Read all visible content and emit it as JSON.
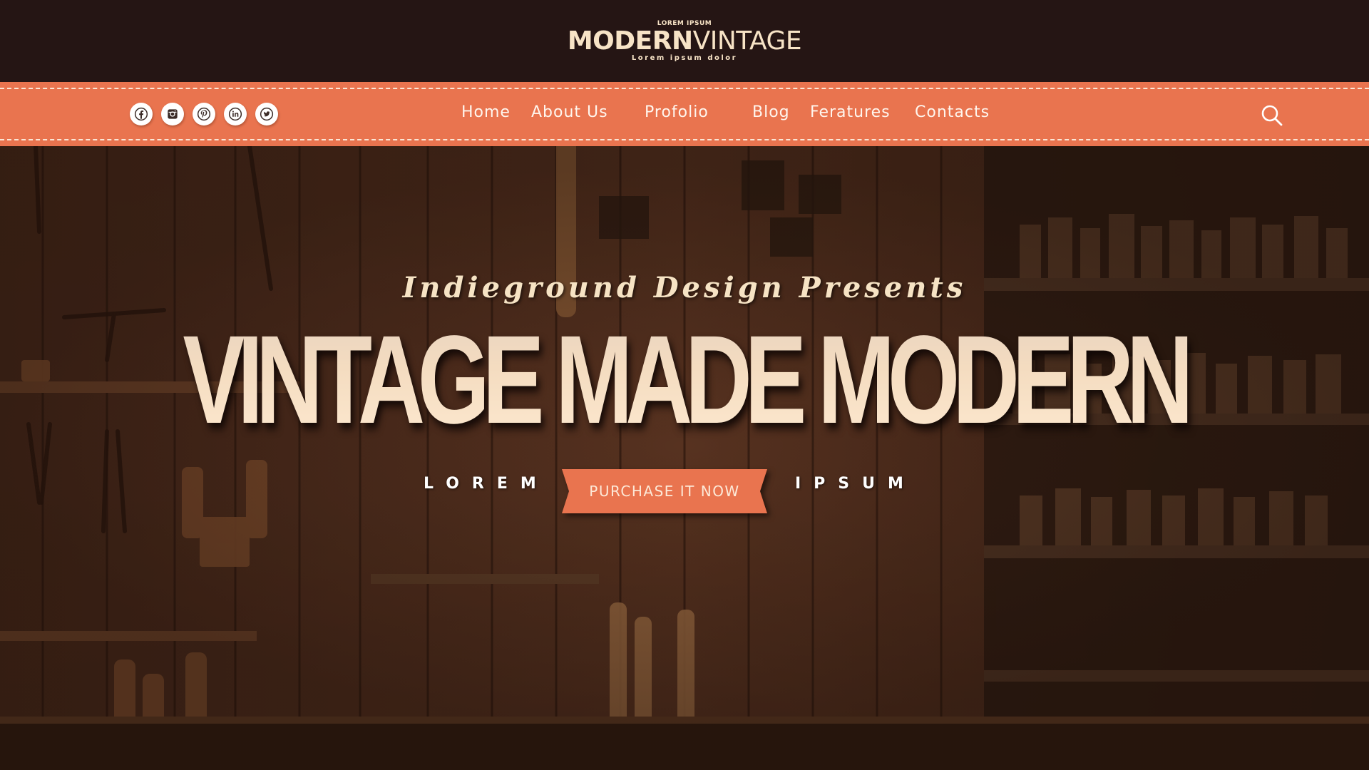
{
  "brand": {
    "kicker": "LOREM IPSUM",
    "name_bold": "MODERN",
    "name_light": "VINTAGE",
    "tagline": "Lorem ipsum dolor"
  },
  "colors": {
    "topbar": "#251514",
    "nav": "#e9744f",
    "cream": "#f6e3c4",
    "cta": "#e9744f"
  },
  "socials": [
    {
      "icon": "facebook-icon"
    },
    {
      "icon": "instagram-icon"
    },
    {
      "icon": "pinterest-icon"
    },
    {
      "icon": "linkedin-icon"
    },
    {
      "icon": "twitter-icon"
    }
  ],
  "nav": {
    "items": [
      {
        "label": "Home"
      },
      {
        "label": "About Us"
      },
      {
        "label": "Profolio"
      },
      {
        "label": "Blog"
      },
      {
        "label": "Feratures"
      },
      {
        "label": "Contacts"
      }
    ],
    "search_icon": "search-icon"
  },
  "hero": {
    "presents": "Indieground Design Presents",
    "headline": "VINTAGE MADE MODERN",
    "left_word": "LOREM",
    "right_word": "IPSUM",
    "cta_label": "PURCHASE IT NOW"
  }
}
